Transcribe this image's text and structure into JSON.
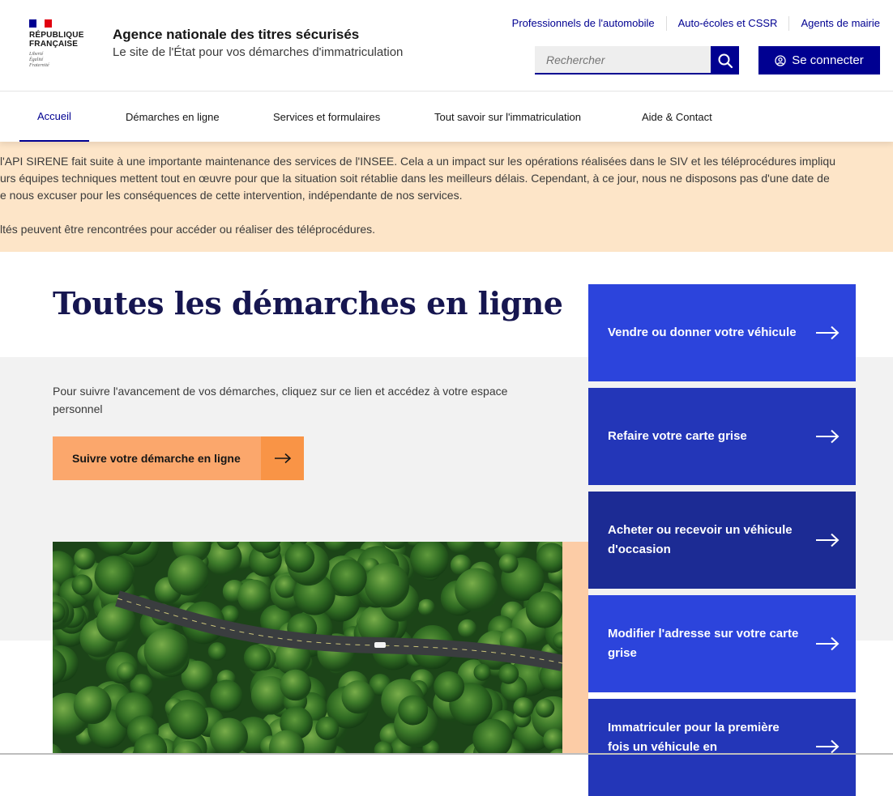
{
  "header": {
    "logo_text_1": "RÉPUBLIQUE",
    "logo_text_2": "FRANÇAISE",
    "motto_1": "Liberté",
    "motto_2": "Égalité",
    "motto_3": "Fraternité",
    "site_title": "Agence nationale des titres sécurisés",
    "site_subtitle": "Le site de l'État pour vos démarches d'immatriculation",
    "top_links": [
      "Professionnels de l'automobile",
      "Auto-écoles et CSSR",
      "Agents de mairie"
    ],
    "search_placeholder": "Rechercher",
    "login_label": "Se connecter"
  },
  "nav": {
    "items": [
      "Accueil",
      "Démarches en ligne",
      "Services et formulaires",
      "Tout savoir sur l'immatriculation",
      "Aide & Contact"
    ],
    "active": "Accueil"
  },
  "notice": {
    "line_1": "l'API SIRENE fait suite à une importante maintenance des services de l'INSEE.  Cela a un impact sur les opérations réalisées dans le SIV et les téléprocédures impliqu",
    "line_2": "urs équipes techniques mettent tout en œuvre pour que la situation soit rétablie dans les meilleurs délais. Cependant, à ce jour, nous ne disposons pas d'une date de",
    "line_3": "e nous excuser pour les conséquences de cette intervention, indépendante de nos services.",
    "line_4": "ltés peuvent être rencontrées  pour accéder ou réaliser des téléprocédures."
  },
  "main": {
    "title": "Toutes les démarches en ligne",
    "intro": "Pour suivre l'avancement de vos démarches, cliquez sur ce lien et accédez à votre espace personnel",
    "follow_label": "Suivre votre démarche en ligne"
  },
  "cards": [
    {
      "label": "Vendre ou donner votre véhicule",
      "color": "#2c44dc"
    },
    {
      "label": "Refaire votre carte grise",
      "color": "#2336b8"
    },
    {
      "label": "Acheter ou recevoir un véhicule d'occasion",
      "color": "#1c2b94"
    },
    {
      "label": "Modifier l'adresse sur votre carte grise",
      "color": "#2c44dc"
    },
    {
      "label": "Immatriculer pour la première fois un véhicule en",
      "color": "#2336b8"
    }
  ],
  "colors": {
    "brand_blue": "#000091",
    "notice_bg": "#fde5c8",
    "follow_orange": "#fba76c",
    "follow_orange_dark": "#f99446"
  }
}
